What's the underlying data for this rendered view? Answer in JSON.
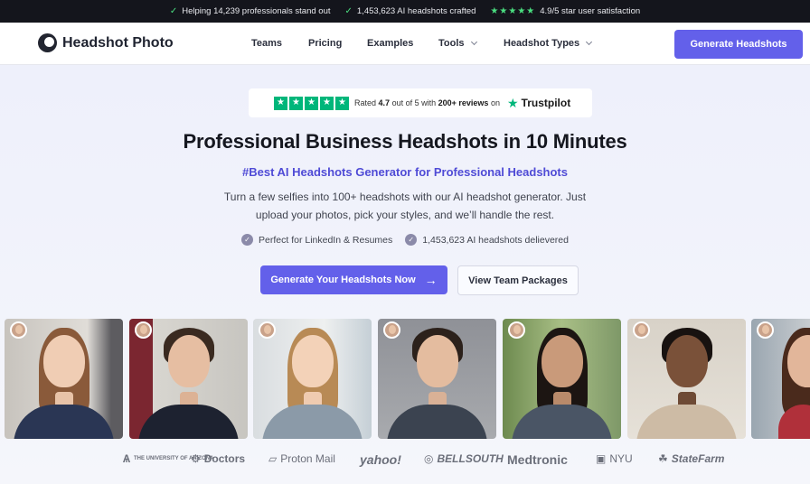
{
  "topbar": {
    "items": [
      {
        "text": "Helping 14,239 professionals stand out"
      },
      {
        "text": "1,453,623 AI headshots crafted"
      },
      {
        "text": "4.9/5 star user satisfaction",
        "stars": "★★★★★"
      }
    ]
  },
  "nav": {
    "logo": "Headshot Photo",
    "menu": [
      "Teams",
      "Pricing",
      "Examples",
      "Tools",
      "Headshot Types"
    ],
    "cta": "Generate Headshots"
  },
  "trustpilot": {
    "prefix": "Rated",
    "rating": "4.7",
    "middle": "out of 5 with",
    "reviews": "200+ reviews",
    "suffix": "on",
    "brand": "Trustpilot"
  },
  "hero": {
    "title": "Professional Business Headshots in 10 Minutes",
    "subtitle": "#Best AI Headshots Generator for Professional Headshots",
    "description": "Turn a few selfies into 100+ headshots with our AI headshot generator. Just upload your photos, pick your styles, and we’ll handle the rest.",
    "checks": [
      "Perfect for LinkedIn & Resumes",
      "1,453,623 AI headshots delievered"
    ],
    "primary_cta": "Generate Your Headshots Now",
    "secondary_cta": "View Team Packages"
  },
  "logos": [
    "THE UNIVERSITY OF ARIZONA",
    "Doctors",
    "Proton Mail",
    "yahoo!",
    "BELLSOUTH",
    "Medtronic",
    "NYU",
    "StateFarm"
  ],
  "colors": {
    "accent": "#6360ea",
    "subtitle": "#4f4bd6",
    "trustpilot_green": "#00b67a",
    "topbar_bg": "#14151c"
  }
}
